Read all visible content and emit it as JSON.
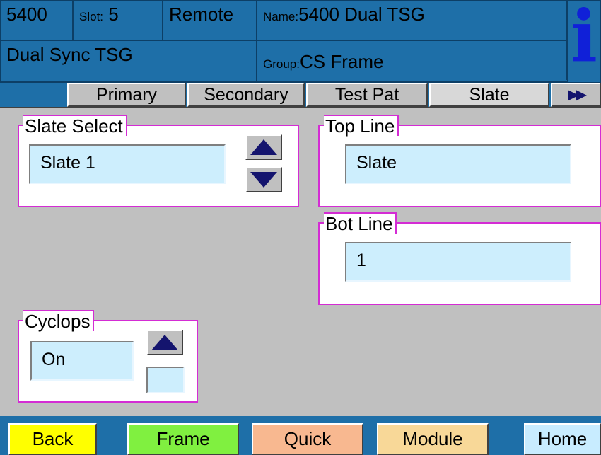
{
  "header": {
    "model": "5400",
    "slot_label": "Slot:",
    "slot_value": "5",
    "mode": "Remote",
    "name_label": "Name:",
    "name_value": "5400 Dual TSG",
    "device_type": "Dual Sync TSG",
    "group_label": "Group:",
    "group_value": "CS Frame",
    "info_icon": "i"
  },
  "tabs": [
    {
      "label": "Primary",
      "active": false
    },
    {
      "label": "Secondary",
      "active": false
    },
    {
      "label": "Test Pat",
      "active": false
    },
    {
      "label": "Slate",
      "active": true
    }
  ],
  "tab_scroll_icon": "▶▶",
  "slate_select": {
    "label": "Slate Select",
    "value": "Slate 1"
  },
  "top_line": {
    "label": "Top Line",
    "value": "Slate"
  },
  "bot_line": {
    "label": "Bot Line",
    "value": "1"
  },
  "cyclops": {
    "label": "Cyclops",
    "value": "On"
  },
  "nav": {
    "back": "Back",
    "frame": "Frame",
    "quick": "Quick",
    "module": "Module",
    "home": "Home"
  },
  "colors": {
    "header_blue": "#1e6fa8",
    "group_border": "#d42cd4",
    "field_bg": "#cdeefd",
    "back_btn": "#ffff00",
    "frame_btn": "#80f040",
    "quick_btn": "#f8b890",
    "module_btn": "#f8d898",
    "home_btn": "#c8ecff"
  }
}
